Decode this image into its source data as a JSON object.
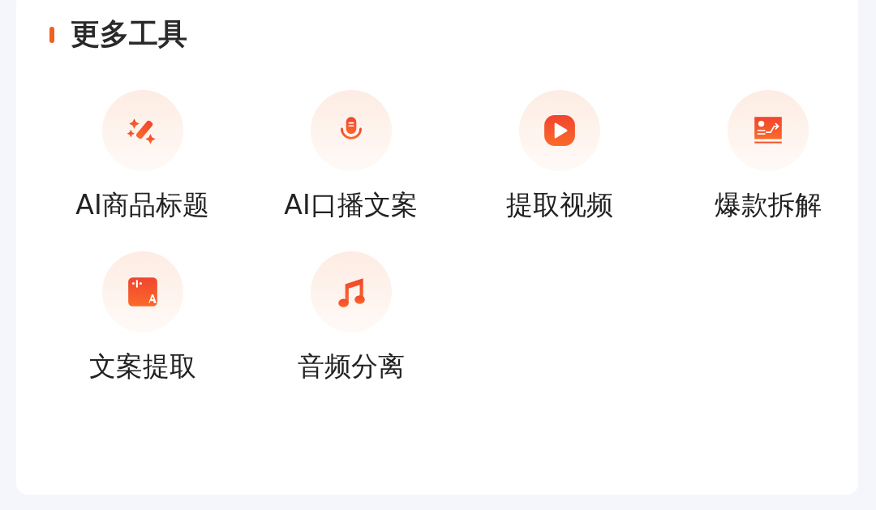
{
  "section": {
    "title": "更多工具"
  },
  "tools": [
    {
      "label": "AI商品标题"
    },
    {
      "label": "AI口播文案"
    },
    {
      "label": "提取视频"
    },
    {
      "label": "爆款拆解"
    },
    {
      "label": "文案提取"
    },
    {
      "label": "音频分离"
    }
  ]
}
